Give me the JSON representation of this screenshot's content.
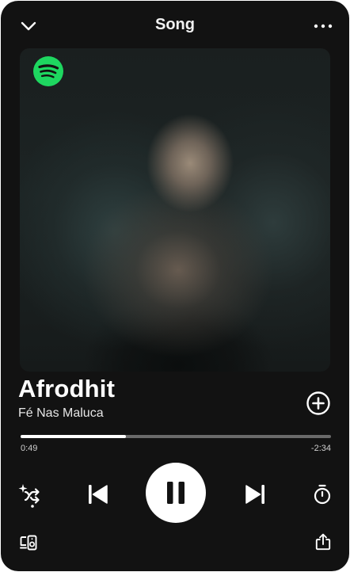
{
  "header": {
    "title": "Song",
    "back_icon": "chevron-down-icon",
    "more_icon": "more-horizontal-icon"
  },
  "artwork": {
    "logo_icon": "spotify-logo-icon",
    "logo_color": "#1ED760"
  },
  "track": {
    "title": "Afrodhit",
    "artist": "Fé Nas Maluca",
    "add_icon": "add-circle-icon"
  },
  "progress": {
    "elapsed": "0:49",
    "remaining": "-2:34",
    "fraction": 0.34
  },
  "controls": {
    "shuffle_icon": "smart-shuffle-icon",
    "previous_icon": "skip-previous-icon",
    "play_pause_icon": "pause-icon",
    "next_icon": "skip-next-icon",
    "sleep_timer_icon": "timer-icon",
    "devices_icon": "devices-icon",
    "share_icon": "share-icon"
  },
  "colors": {
    "background": "#121212",
    "accent": "#1ED760",
    "progress_track": "#6A6A6A",
    "progress_fill": "#FFFFFF"
  }
}
